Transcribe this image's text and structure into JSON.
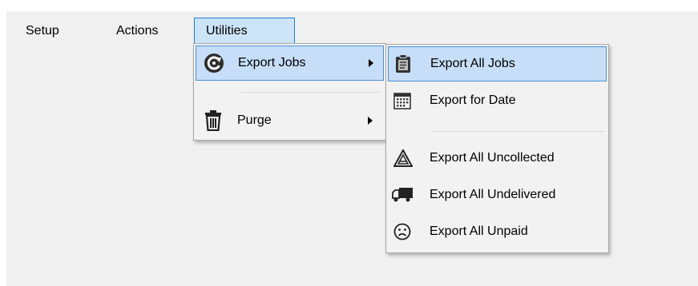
{
  "menubar": {
    "items": [
      {
        "label": "Setup"
      },
      {
        "label": "Actions"
      },
      {
        "label": "Utilities"
      }
    ]
  },
  "utilities_menu": {
    "items": [
      {
        "label": "Export Jobs",
        "icon": "refresh-icon"
      },
      {
        "label": "Purge",
        "icon": "trash-icon"
      }
    ]
  },
  "export_jobs_menu": {
    "items": [
      {
        "label": "Export All Jobs",
        "icon": "clipboard-icon"
      },
      {
        "label": "Export for Date",
        "icon": "calendar-icon"
      },
      {
        "label": "Export All Uncollected",
        "icon": "warning-triangle-icon"
      },
      {
        "label": "Export All Undelivered",
        "icon": "truck-icon"
      },
      {
        "label": "Export All Unpaid",
        "icon": "sad-face-icon"
      }
    ]
  },
  "colors": {
    "highlight": "#c6def7",
    "highlight_border": "#4a8fd8",
    "menubar_active": "#cce4f7"
  }
}
